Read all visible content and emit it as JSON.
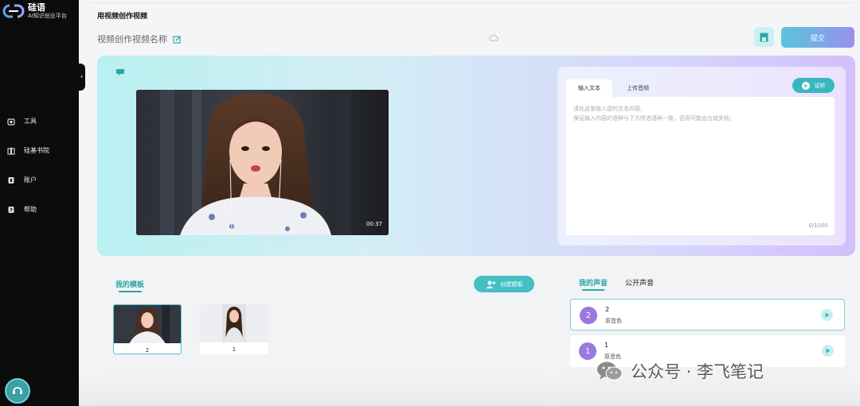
{
  "brand": {
    "name": "硅语",
    "subtitle": "AI知识创业平台"
  },
  "sidebar": {
    "items": [
      {
        "label": "工具",
        "icon": "toolbox-icon"
      },
      {
        "label": "硅基书院",
        "icon": "book-icon"
      },
      {
        "label": "账户",
        "icon": "account-icon"
      },
      {
        "label": "帮助",
        "icon": "help-icon"
      }
    ]
  },
  "header": {
    "title": "用视频创作视频",
    "video_name": "视频创作视频名称",
    "submit_label": "提交"
  },
  "video": {
    "duration": "00:37"
  },
  "text_input": {
    "tabs": [
      "输入文本",
      "上传音频"
    ],
    "active_tab": "输入文本",
    "try_label": "试听",
    "placeholder_line1": "请在这里输入您的文本内容，",
    "placeholder_line2": "保证输入内容的语种与下方所选语种一致，否则可能会合成失败。",
    "char_count": "0/1000"
  },
  "templates": {
    "title": "我的模板",
    "create_label": "创建模板",
    "items": [
      {
        "label": "2",
        "selected": true
      },
      {
        "label": "1",
        "selected": false
      }
    ]
  },
  "voices": {
    "tabs": [
      "我的声音",
      "公开声音"
    ],
    "active_tab": "我的声音",
    "items": [
      {
        "num": "2",
        "name": "2",
        "desc": "原音色",
        "selected": true
      },
      {
        "num": "1",
        "name": "1",
        "desc": "原音色",
        "selected": false
      }
    ]
  },
  "watermark": {
    "text": "公众号 · 李飞笔记"
  },
  "colors": {
    "accent": "#2aa5a5",
    "submit_start": "#58c6da",
    "submit_end": "#9a8ff0",
    "voice_badge": "#9b77e0"
  }
}
